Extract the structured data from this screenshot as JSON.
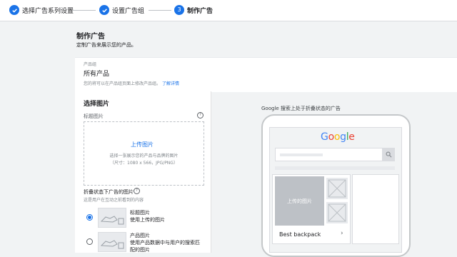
{
  "stepper": {
    "steps": [
      {
        "label": "选择广告系列设置",
        "state": "done"
      },
      {
        "label": "设置广告组",
        "state": "done"
      },
      {
        "label": "制作广告",
        "state": "current",
        "number": "3"
      }
    ]
  },
  "page": {
    "title": "制作广告",
    "subtitle": "定制广告来展示您的产品。"
  },
  "product_group": {
    "label": "产品组",
    "value": "所有产品",
    "hint": "您的将可以在产品组页面上修改产品组。",
    "link": "了解详情"
  },
  "image_section": {
    "title": "选择图片",
    "header_image_label": "标题图片",
    "upload_link": "上传图片",
    "upload_hint_1": "选择一张展示您的产品与品牌的图片",
    "upload_hint_2": "（尺寸：1080 x 566，JPG/PNG）",
    "collapsed_label": "折叠状态下广告的图片",
    "collapsed_hint": "这是用户在互动之前看到的内容",
    "options": [
      {
        "line1": "标题图片",
        "line2": "使用上传的图片",
        "selected": true
      },
      {
        "line1": "产品图片",
        "line2": "使用产品数据中与用户的搜索匹",
        "line3": "配的图片",
        "selected": false
      }
    ]
  },
  "preview": {
    "title": "Google 搜索上处于折叠状态的广告",
    "logo_text": "Google",
    "logo_colors": [
      "#4285F4",
      "#EA4335",
      "#FBBC05",
      "#4285F4",
      "#34A853",
      "#EA4335"
    ],
    "image_placeholder": "上传的图片",
    "ad_title": "Best backpack",
    "chevron": "›"
  },
  "colors": {
    "accent": "#1a73e8",
    "background": "#f1f3f4"
  }
}
